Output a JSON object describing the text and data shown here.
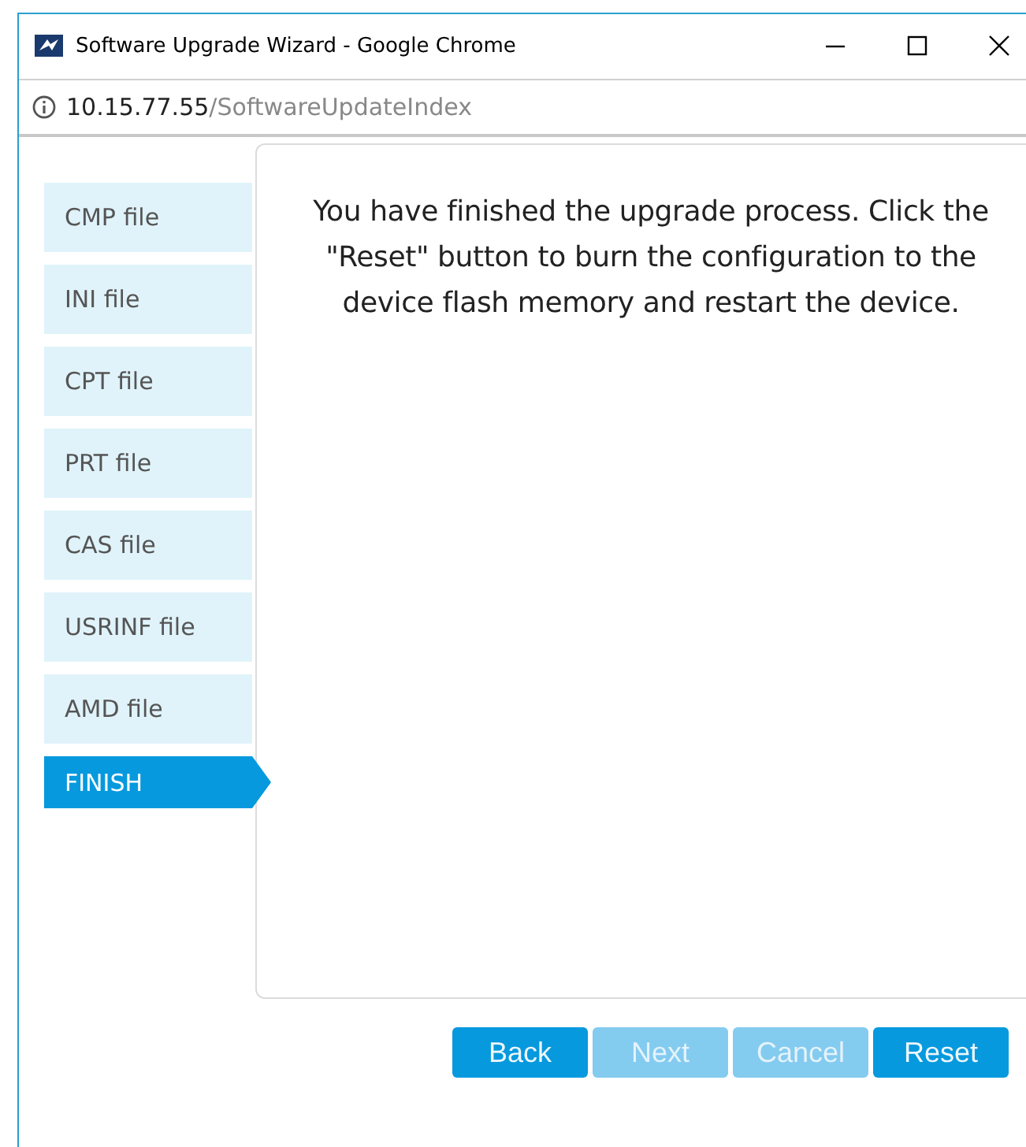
{
  "window": {
    "title": "Software Upgrade Wizard - Google Chrome"
  },
  "address_bar": {
    "host": "10.15.77.55",
    "path": "/SoftwareUpdateIndex"
  },
  "steps": [
    {
      "label": "CMP file",
      "selected": false
    },
    {
      "label": "INI file",
      "selected": false
    },
    {
      "label": "CPT file",
      "selected": false
    },
    {
      "label": "PRT file",
      "selected": false
    },
    {
      "label": "CAS file",
      "selected": false
    },
    {
      "label": "USRINF file",
      "selected": false
    },
    {
      "label": "AMD file",
      "selected": false
    },
    {
      "label": "FINISH",
      "selected": true
    }
  ],
  "message": "You have finished the upgrade process. Click the \"Reset\" button to burn the configuration to the device flash memory and restart the device.",
  "buttons": [
    {
      "label": "Back",
      "disabled": false
    },
    {
      "label": "Next",
      "disabled": true
    },
    {
      "label": "Cancel",
      "disabled": true
    },
    {
      "label": "Reset",
      "disabled": false
    }
  ]
}
